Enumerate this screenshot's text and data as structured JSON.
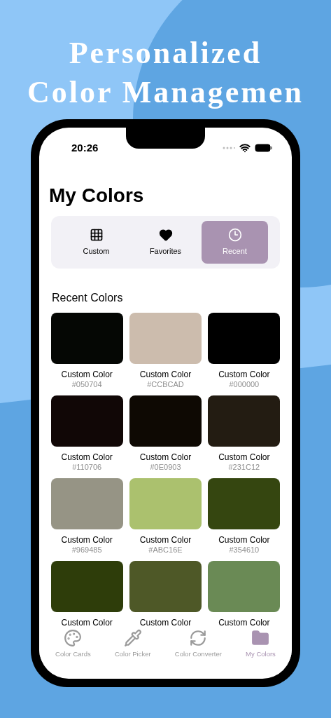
{
  "headline": [
    "Personalized",
    "Color Managemen"
  ],
  "status_bar": {
    "time": "20:26"
  },
  "title": "My Colors",
  "segments": [
    {
      "label": "Custom",
      "selected": false
    },
    {
      "label": "Favorites",
      "selected": false
    },
    {
      "label": "Recent",
      "selected": true
    }
  ],
  "section_title": "Recent Colors",
  "colors": [
    {
      "name": "Custom Color",
      "hex": "#050704",
      "color": "#050704"
    },
    {
      "name": "Custom Color",
      "hex": "#CCBCAD",
      "color": "#ccbcad"
    },
    {
      "name": "Custom Color",
      "hex": "#000000",
      "color": "#000000"
    },
    {
      "name": "Custom Color",
      "hex": "#110706",
      "color": "#110706"
    },
    {
      "name": "Custom Color",
      "hex": "#0E0903",
      "color": "#0e0903"
    },
    {
      "name": "Custom Color",
      "hex": "#231C12",
      "color": "#231c12"
    },
    {
      "name": "Custom Color",
      "hex": "#969485",
      "color": "#969485"
    },
    {
      "name": "Custom Color",
      "hex": "#ABC16E",
      "color": "#abc16e"
    },
    {
      "name": "Custom Color",
      "hex": "#354610",
      "color": "#354610"
    },
    {
      "name": "Custom Color",
      "color": "#2e3d0a"
    },
    {
      "name": "Custom Color",
      "color": "#4e5827"
    },
    {
      "name": "Custom Color",
      "color": "#6a8a55"
    }
  ],
  "tab_bar": [
    {
      "label": "Color Cards",
      "selected": false
    },
    {
      "label": "Color Picker",
      "selected": false
    },
    {
      "label": "Color Converter",
      "selected": false
    },
    {
      "label": "My Colors",
      "selected": true
    }
  ]
}
